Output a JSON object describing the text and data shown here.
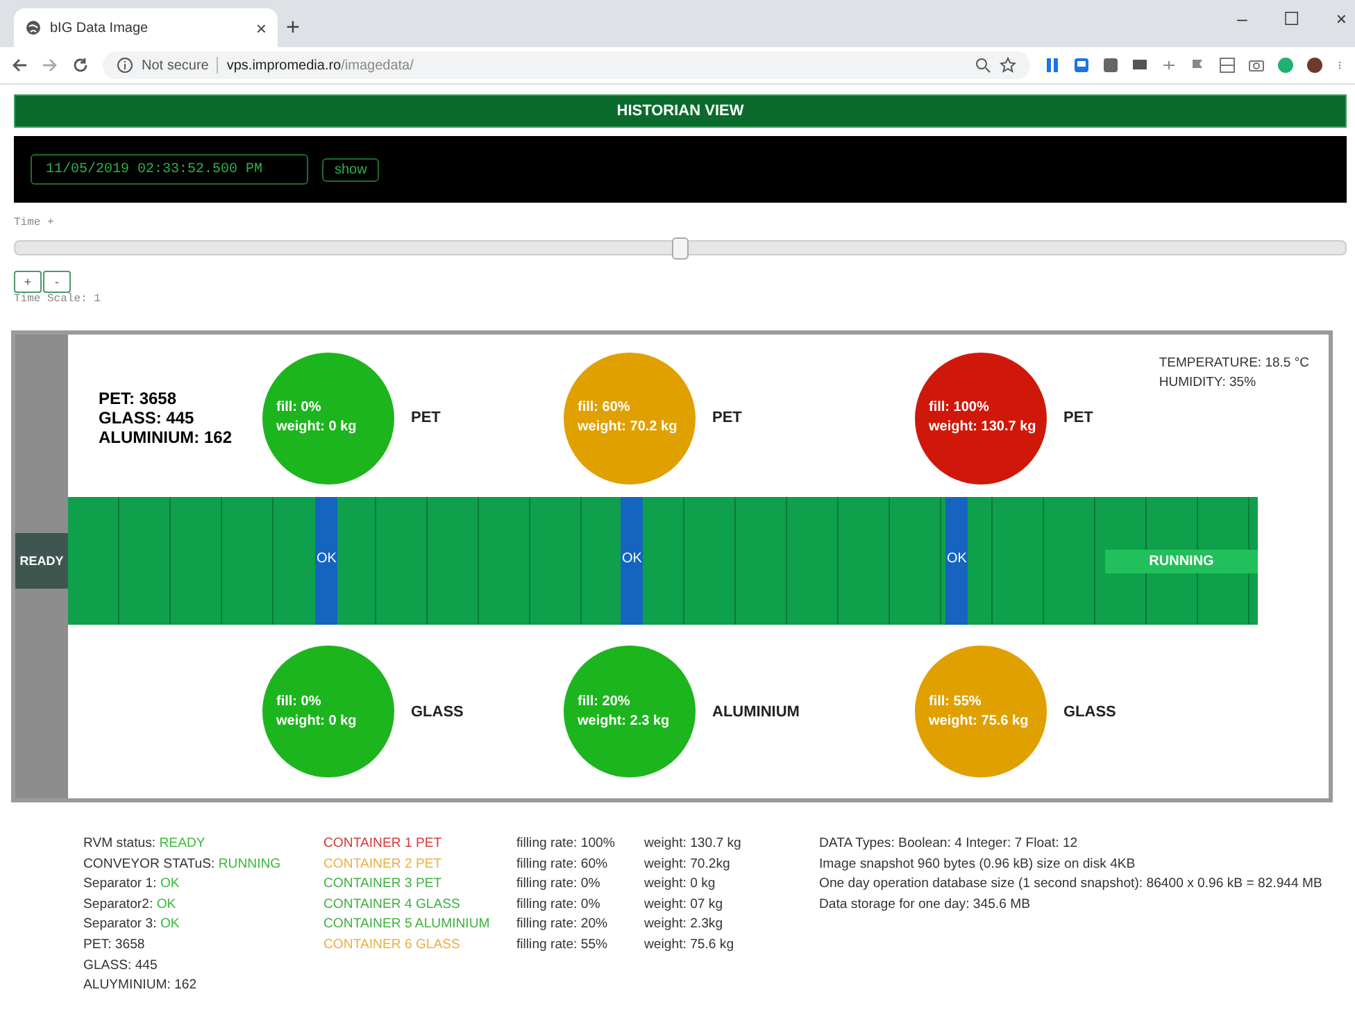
{
  "browser": {
    "tab_title": "bIG Data Image",
    "tab_close": "×",
    "new_tab": "+",
    "security": "Not secure",
    "url_host": "vps.impromedia.ro",
    "url_path": "/imagedata/",
    "window_controls": [
      "–",
      "☐",
      "×"
    ]
  },
  "header": {
    "title": "HISTORIAN VIEW"
  },
  "time_panel": {
    "datetime": "11/05/2019 02:33:52.500 PM",
    "show_button": "show"
  },
  "time_slider": {
    "label": "Time +",
    "level": 0.5
  },
  "scale": {
    "buttons": [
      "+",
      "-"
    ],
    "label": "Time Scale: 1"
  },
  "diagram": {
    "counts": [
      "PET: 3658",
      "GLASS: 445",
      "ALUMINIUM: 162"
    ],
    "environment": [
      "TEMPERATURE: 18.5 °C",
      "HUMIDITY: 35%"
    ],
    "rvm_status": "READY",
    "conveyor_status": "RUNNING",
    "top_containers": [
      {
        "fill": "fill: 0%",
        "weight": "weight: 0 kg",
        "label": "PET",
        "color": "#1db51d"
      },
      {
        "fill": "fill: 60%",
        "weight": "weight: 70.2 kg",
        "label": "PET",
        "color": "#e0a000"
      },
      {
        "fill": "fill: 100%",
        "weight": "weight: 130.7 kg",
        "label": "PET",
        "color": "#d0180a"
      }
    ],
    "separators": [
      "OK",
      "OK",
      "OK"
    ],
    "bottom_containers": [
      {
        "fill": "fill: 0%",
        "weight": "weight: 0 kg",
        "label": "GLASS",
        "color": "#1db51d"
      },
      {
        "fill": "fill: 20%",
        "weight": "weight: 2.3 kg",
        "label": "ALUMINIUM",
        "color": "#1db51d"
      },
      {
        "fill": "fill: 55%",
        "weight": "weight: 75.6 kg",
        "label": "GLASS",
        "color": "#e0a000"
      }
    ]
  },
  "status": {
    "lines": [
      {
        "label": "RVM status: ",
        "value": "READY"
      },
      {
        "label": "CONVEYOR STATuS: ",
        "value": "RUNNING"
      },
      {
        "label": "Separator 1: ",
        "value": "OK"
      },
      {
        "label": "Separator2: ",
        "value": "OK"
      },
      {
        "label": "Separator 3: ",
        "value": "OK"
      },
      {
        "label": "PET:  3658"
      },
      {
        "label": "GLASS: 445"
      },
      {
        "label": "ALUYMINIUM: 162"
      }
    ],
    "containers": [
      {
        "name": "CONTAINER 1 PET",
        "color": "#d03a3a",
        "rate": "filling rate: 100%",
        "weight": "weight: 130.7 kg"
      },
      {
        "name": "CONTAINER 2 PET",
        "color": "#e8b040",
        "rate": "filling rate: 60%",
        "weight": "weight: 70.2kg"
      },
      {
        "name": "CONTAINER 3 PET",
        "color": "#40b040",
        "rate": "filling rate: 0%",
        "weight": "weight: 0 kg"
      },
      {
        "name": "CONTAINER 4 GLASS",
        "color": "#40b040",
        "rate": "filling rate: 0%",
        "weight": "weight: 07 kg"
      },
      {
        "name": "CONTAINER 5 ALUMINIUM",
        "color": "#40b040",
        "rate": "filling rate: 20%",
        "weight": "weight: 2.3kg"
      },
      {
        "name": "CONTAINER 6 GLASS",
        "color": "#e8b040",
        "rate": "filling rate: 55%",
        "weight": "weight: 75.6 kg"
      }
    ],
    "info": [
      "DATA Types: Boolean: 4 Integer: 7 Float: 12",
      "Image snapshot 960 bytes (0.96 kB) size on disk 4KB",
      "One day  operation database size (1 second snapshot): 86400 x 0.96 kB = 82.944 MB",
      "Data storage for one day: 345.6 MB"
    ]
  }
}
